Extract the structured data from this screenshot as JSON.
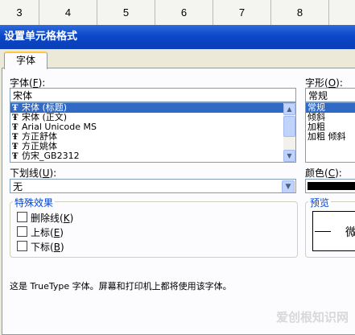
{
  "columns": [
    "3",
    "4",
    "5",
    "6",
    "7",
    "8"
  ],
  "title": "设置单元格格式",
  "tab_label": "字体",
  "font": {
    "label": "字体",
    "hotkey": "F",
    "value": "宋体",
    "items": [
      {
        "label": "宋体 (标题)",
        "selected": true
      },
      {
        "label": "宋体 (正文)",
        "selected": false
      },
      {
        "label": "Arial Unicode MS",
        "selected": false
      },
      {
        "label": "方正舒体",
        "selected": false
      },
      {
        "label": "方正姚体",
        "selected": false
      },
      {
        "label": "仿宋_GB2312",
        "selected": false
      }
    ]
  },
  "style": {
    "label": "字形",
    "hotkey": "O",
    "value": "常规",
    "items": [
      {
        "label": "常规",
        "selected": true
      },
      {
        "label": "倾斜",
        "selected": false
      },
      {
        "label": "加粗",
        "selected": false
      },
      {
        "label": "加粗 倾斜",
        "selected": false
      }
    ]
  },
  "underline": {
    "label": "下划线",
    "hotkey": "U",
    "value": "无"
  },
  "color": {
    "label": "颜色",
    "hotkey": "C",
    "value_hex": "#000000"
  },
  "effects": {
    "title": "特殊效果",
    "items": [
      {
        "label": "删除线",
        "hotkey": "K",
        "checked": false
      },
      {
        "label": "上标",
        "hotkey": "E",
        "checked": false
      },
      {
        "label": "下标",
        "hotkey": "B",
        "checked": false
      }
    ]
  },
  "preview": {
    "title": "预览",
    "sample": "微"
  },
  "footer_text": "这是 TrueType 字体。屏幕和打印机上都将使用该字体。",
  "watermark": "爱创根知识网",
  "colors": {
    "title_bar": "#0b47c9",
    "selection": "#316ac5",
    "group_title": "#0046d5"
  }
}
